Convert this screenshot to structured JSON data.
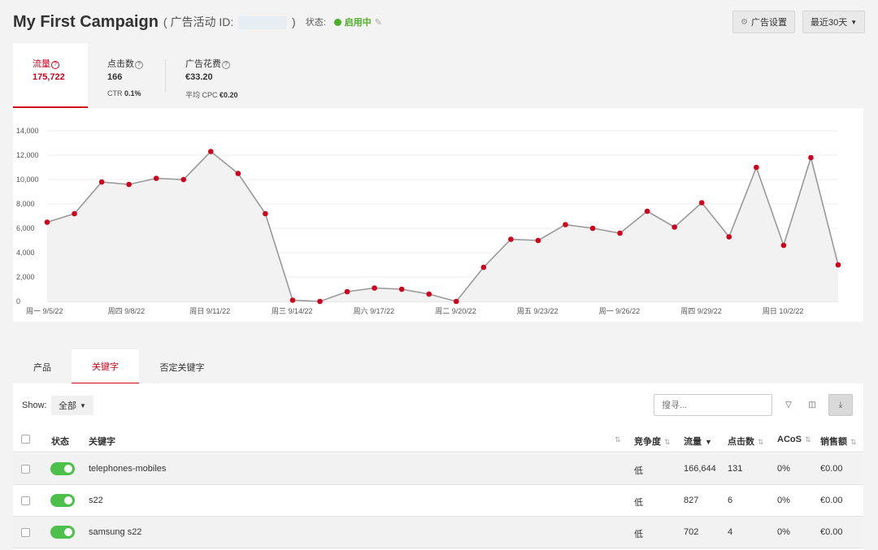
{
  "header": {
    "title": "My First Campaign",
    "id_prefix": "( 广告活动 ID:",
    "id_suffix": ")",
    "status_label": "状态:",
    "status_value": "启用中"
  },
  "toolbar": {
    "settings_label": "广告设置",
    "range_label": "最近30天"
  },
  "metrics": {
    "traffic": {
      "label": "流量",
      "value": "175,722"
    },
    "clicks": {
      "label": "点击数",
      "value": "166",
      "sub_label": "CTR",
      "sub_value": "0.1%"
    },
    "spend": {
      "label": "广告花费",
      "value": "€33.20",
      "sub_label": "平均 CPC",
      "sub_value": "€0.20"
    }
  },
  "chart_data": {
    "type": "area",
    "title": "",
    "xlabel": "",
    "ylabel": "",
    "ylim": [
      0,
      14000
    ],
    "yticks": [
      "0",
      "2,000",
      "4,000",
      "6,000",
      "8,000",
      "10,000",
      "12,000",
      "14,000"
    ],
    "xtick_labels": [
      "周一 9/5/22",
      "周四 9/8/22",
      "周日 9/11/22",
      "周三 9/14/22",
      "周六 9/17/22",
      "周二 9/20/22",
      "周五 9/23/22",
      "周一 9/26/22",
      "周四 9/29/22",
      "周日 10/2/22"
    ],
    "x": [
      "9/5/22",
      "9/6/22",
      "9/7/22",
      "9/8/22",
      "9/9/22",
      "9/10/22",
      "9/11/22",
      "9/12/22",
      "9/13/22",
      "9/14/22",
      "9/15/22",
      "9/16/22",
      "9/17/22",
      "9/18/22",
      "9/19/22",
      "9/20/22",
      "9/21/22",
      "9/22/22",
      "9/23/22",
      "9/24/22",
      "9/25/22",
      "9/26/22",
      "9/27/22",
      "9/28/22",
      "9/29/22",
      "9/30/22",
      "10/1/22",
      "10/2/22",
      "10/3/22",
      "10/4/22"
    ],
    "series": [
      {
        "values": [
          6500,
          7200,
          9800,
          9600,
          10100,
          10000,
          12300,
          10500,
          7200,
          100,
          0,
          800,
          1100,
          1000,
          600,
          0,
          2800,
          5100,
          5000,
          6300,
          6000,
          5600,
          7400,
          6100,
          8100,
          5300,
          11000,
          4600,
          11800,
          3000
        ]
      }
    ],
    "grid": true,
    "legend": "none",
    "line_color": "#999999",
    "marker_color": "#d0021b",
    "fill_color": "#f2f2f2"
  },
  "tabs": [
    "产品",
    "关键字",
    "否定关键字"
  ],
  "table": {
    "show_label": "Show:",
    "show_value": "全部",
    "search_placeholder": "搜寻...",
    "headers": {
      "status": "状态",
      "keyword": "关键字",
      "competition": "竞争度",
      "traffic": "流量",
      "clicks": "点击数",
      "acos": "ACoS",
      "sales": "销售额"
    },
    "rows": [
      {
        "enabled": true,
        "keyword": "telephones-mobiles",
        "competition": "低",
        "traffic": "166,644",
        "clicks": "131",
        "acos": "0%",
        "sales": "€0.00"
      },
      {
        "enabled": true,
        "keyword": "s22",
        "competition": "低",
        "traffic": "827",
        "clicks": "6",
        "acos": "0%",
        "sales": "€0.00"
      },
      {
        "enabled": true,
        "keyword": "samsung s22",
        "competition": "低",
        "traffic": "702",
        "clicks": "4",
        "acos": "0%",
        "sales": "€0.00"
      }
    ]
  },
  "colors": {
    "accent": "#d0021b",
    "status_green": "#4caf2a",
    "toggle_green": "#4cc04a"
  }
}
